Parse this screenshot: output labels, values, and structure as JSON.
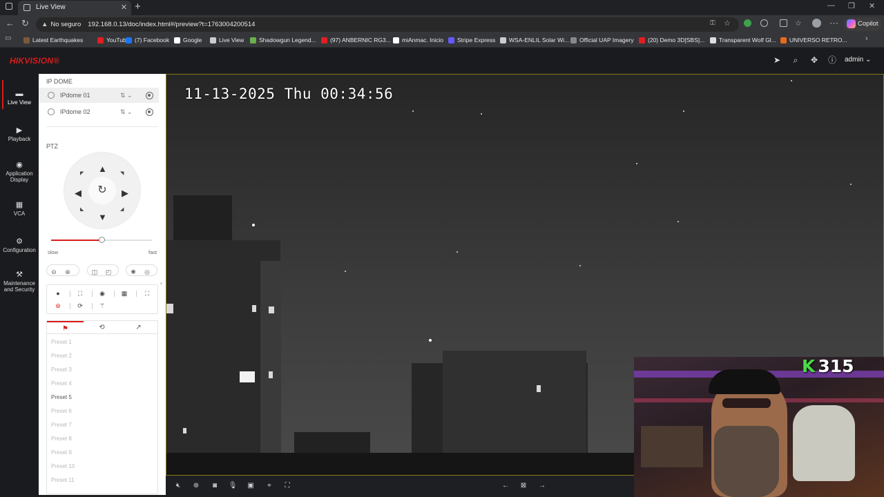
{
  "browser": {
    "tab_title": "Live View",
    "new_tab_symbol": "+",
    "address": {
      "security_label": "No seguro",
      "url": "192.168.0.13/doc/index.html#/preview?t=1763004200514"
    },
    "copilot_label": "Copilot",
    "bookmarks": [
      {
        "label": "Latest Earthquakes",
        "color": "#7a5a3a"
      },
      {
        "label": "YouTube",
        "color": "#e02020"
      },
      {
        "label": "(7) Facebook",
        "color": "#1877f2"
      },
      {
        "label": "Google",
        "color": "#ffffff"
      },
      {
        "label": "Live View",
        "color": "#cccccc"
      },
      {
        "label": "Shadowgun Legend...",
        "color": "#6ab04c"
      },
      {
        "label": "(97) ANBERNIC RG3...",
        "color": "#e02020"
      },
      {
        "label": "miAnmac. Inicio",
        "color": "#ffffff"
      },
      {
        "label": "Stripe Express",
        "color": "#635bff"
      },
      {
        "label": "WSA-ENLIL Solar Wi...",
        "color": "#cccccc"
      },
      {
        "label": "Official UAP Imagery",
        "color": "#888888"
      },
      {
        "label": "(20) Demo 3D[SBS]...",
        "color": "#e02020"
      },
      {
        "label": "Transparent Wolf Gl...",
        "color": "#dddddd"
      },
      {
        "label": "UNIVERSO RETRO...",
        "color": "#e86a1a"
      }
    ]
  },
  "app": {
    "brand": "HIKVISION®",
    "user": "admin",
    "nav": [
      {
        "label": "Live View",
        "icon": "live-view-icon"
      },
      {
        "label": "Playback",
        "icon": "playback-icon"
      },
      {
        "label": "Application Display",
        "icon": "application-icon"
      },
      {
        "label": "VCA",
        "icon": "vca-icon"
      },
      {
        "label": "Configuration",
        "icon": "gear-icon"
      },
      {
        "label": "Maintenance and Security",
        "icon": "maintenance-icon"
      }
    ],
    "panel": {
      "group_title": "IP DOME",
      "cameras": [
        {
          "label": "IPdome 01"
        },
        {
          "label": "IPdome 02"
        }
      ],
      "ptz_title": "PTZ",
      "speed_min_label": "slow",
      "speed_max_label": "fast",
      "speed_level": 0.5,
      "presets": [
        {
          "label": "Preset 1",
          "enabled": false
        },
        {
          "label": "Preset 2",
          "enabled": false
        },
        {
          "label": "Preset 3",
          "enabled": false
        },
        {
          "label": "Preset 4",
          "enabled": false
        },
        {
          "label": "Preset 5",
          "enabled": true
        },
        {
          "label": "Preset 6",
          "enabled": false
        },
        {
          "label": "Preset 7",
          "enabled": false
        },
        {
          "label": "Preset 8",
          "enabled": false
        },
        {
          "label": "Preset 9",
          "enabled": false
        },
        {
          "label": "Preset 10",
          "enabled": false
        },
        {
          "label": "Preset 11",
          "enabled": false
        }
      ]
    },
    "video": {
      "osd_timestamp": "11-13-2025 Thu 00:34:56"
    },
    "overlay": {
      "k_label": "K",
      "k_count": "315"
    }
  }
}
